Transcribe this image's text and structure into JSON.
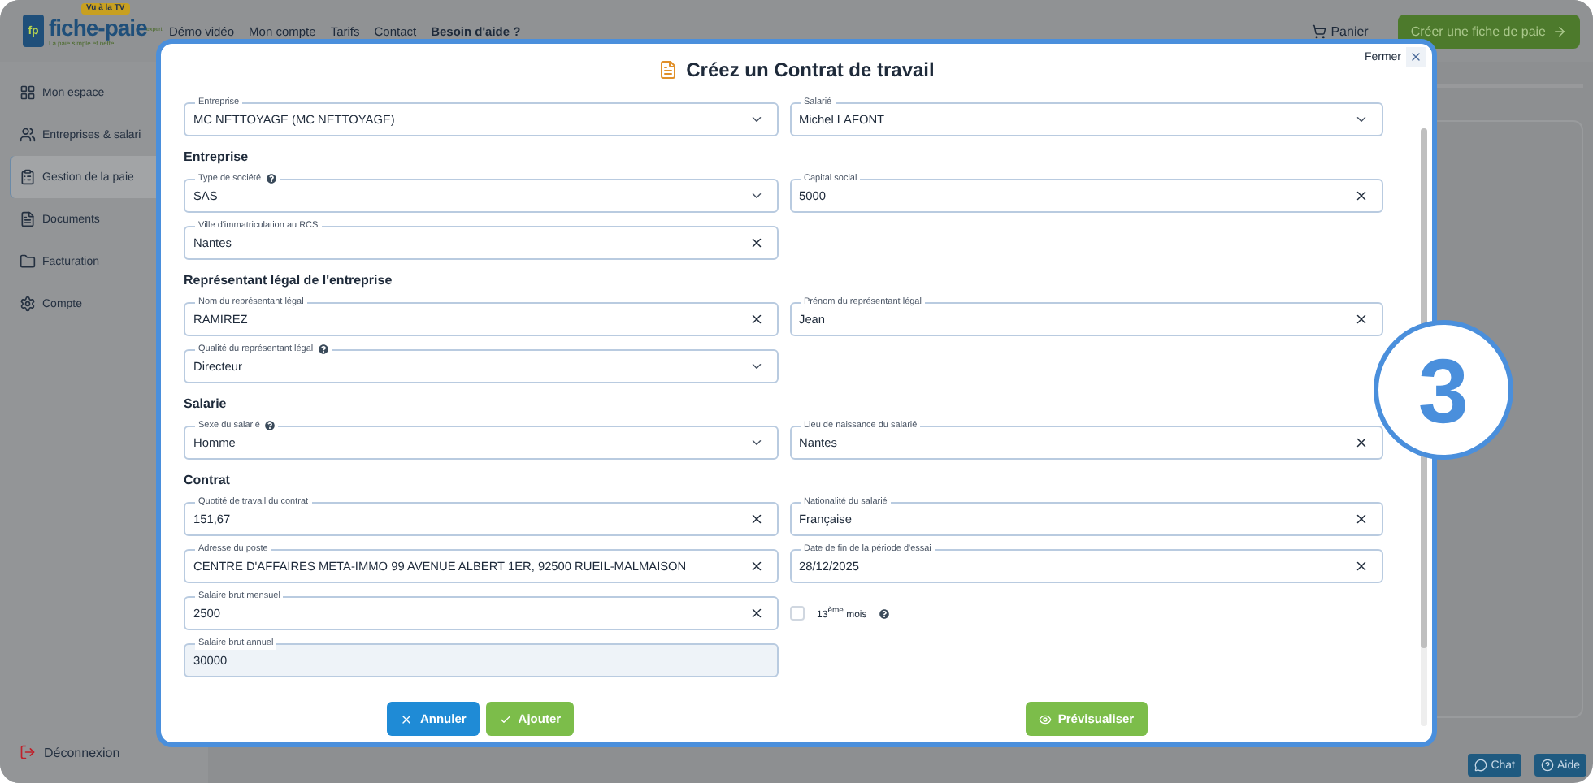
{
  "header": {
    "logo": {
      "mark": "fp",
      "badge": "Vu à la TV",
      "name": "fiche-paie",
      "suffix": "expert",
      "tagline": "La paie simple et nette"
    },
    "nav": [
      {
        "label": "Démo vidéo",
        "bold": false
      },
      {
        "label": "Mon compte",
        "bold": false
      },
      {
        "label": "Tarifs",
        "bold": false
      },
      {
        "label": "Contact",
        "bold": false
      },
      {
        "label": "Besoin d'aide ?",
        "bold": true
      }
    ],
    "cart": "Panier",
    "cta": "Créer une fiche de paie"
  },
  "sidebar": {
    "items": [
      {
        "label": "Mon espace",
        "selected": false
      },
      {
        "label": "Entreprises & salari",
        "selected": false
      },
      {
        "label": "Gestion de la paie",
        "selected": true
      },
      {
        "label": "Documents",
        "selected": false
      },
      {
        "label": "Facturation",
        "selected": false
      },
      {
        "label": "Compte",
        "selected": false
      }
    ],
    "logout": "Déconnexion"
  },
  "modal": {
    "title": "Créez un Contrat de travail",
    "close": "Fermer",
    "rows": [
      {
        "kind": "fields",
        "cells": [
          {
            "kind": "select",
            "label": "Entreprise",
            "value": "MC NETTOYAGE (MC NETTOYAGE)",
            "help": false
          },
          {
            "kind": "select",
            "label": "Salarié",
            "value": "Michel LAFONT",
            "help": false
          }
        ]
      },
      {
        "kind": "heading",
        "text": "Entreprise"
      },
      {
        "kind": "fields",
        "cells": [
          {
            "kind": "select",
            "label": "Type de société",
            "value": "SAS",
            "help": true
          },
          {
            "kind": "text",
            "label": "Capital social",
            "value": "5000",
            "help": false
          }
        ]
      },
      {
        "kind": "fields",
        "cells": [
          {
            "kind": "text",
            "label": "Ville d'immatriculation au RCS",
            "value": "Nantes",
            "help": false
          }
        ]
      },
      {
        "kind": "heading",
        "text": "Représentant légal de l'entreprise"
      },
      {
        "kind": "fields",
        "cells": [
          {
            "kind": "text",
            "label": "Nom du représentant légal",
            "value": "RAMIREZ",
            "help": false
          },
          {
            "kind": "text",
            "label": "Prénom du représentant légal",
            "value": "Jean",
            "help": false
          }
        ]
      },
      {
        "kind": "fields",
        "cells": [
          {
            "kind": "select",
            "label": "Qualité du représentant légal",
            "value": "Directeur",
            "help": true
          }
        ]
      },
      {
        "kind": "heading",
        "text": "Salarie"
      },
      {
        "kind": "fields",
        "cells": [
          {
            "kind": "select",
            "label": "Sexe du salarié",
            "value": "Homme",
            "help": true
          },
          {
            "kind": "text",
            "label": "Lieu de naissance du salarié",
            "value": "Nantes",
            "help": false
          }
        ]
      },
      {
        "kind": "heading",
        "text": "Contrat"
      },
      {
        "kind": "fields",
        "cells": [
          {
            "kind": "text",
            "label": "Quotité de travail du contrat",
            "value": "151,67",
            "help": false
          },
          {
            "kind": "text",
            "label": "Nationalité du salarié",
            "value": "Française",
            "help": false
          }
        ]
      },
      {
        "kind": "fields",
        "cells": [
          {
            "kind": "text",
            "label": "Adresse du poste",
            "value": "CENTRE D'AFFAIRES META-IMMO 99 AVENUE ALBERT 1ER, 92500 RUEIL-MALMAISON",
            "help": false
          },
          {
            "kind": "text",
            "label": "Date de fin de la période d'essai",
            "value": "28/12/2025",
            "help": false
          }
        ]
      },
      {
        "kind": "fields",
        "cells": [
          {
            "kind": "text",
            "label": "Salaire brut mensuel",
            "value": "2500",
            "help": false
          },
          {
            "kind": "checkbox",
            "label": "13$^{ème}$ mois",
            "checked": false,
            "help": true
          }
        ]
      },
      {
        "kind": "fields",
        "cells": [
          {
            "kind": "readonly",
            "label": "Salaire brut annuel",
            "value": "30000",
            "help": false
          }
        ]
      }
    ],
    "actions_left": [
      {
        "kind": "cancel",
        "label": "Annuler"
      },
      {
        "kind": "add",
        "label": "Ajouter"
      }
    ],
    "actions_right": [
      {
        "kind": "preview",
        "label": "Prévisualiser"
      }
    ]
  },
  "step_badge": "3",
  "support": [
    {
      "kind": "chat",
      "label": "Chat"
    },
    {
      "kind": "help",
      "label": "Aide"
    }
  ]
}
